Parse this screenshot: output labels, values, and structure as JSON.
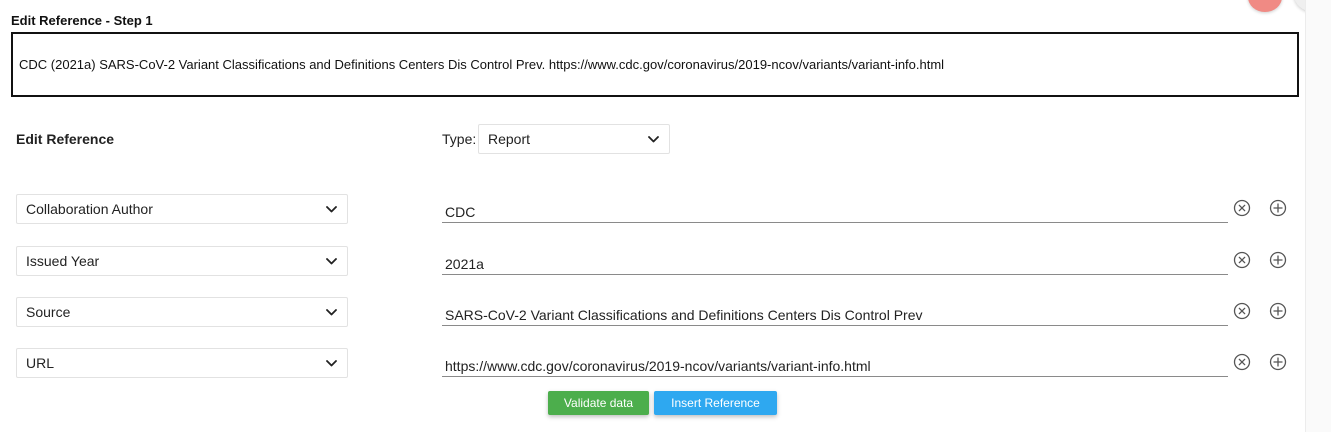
{
  "dialog": {
    "title": "Edit Reference - Step 1",
    "reference_text": "CDC (2021a) SARS-CoV-2 Variant Classifications and Definitions Centers Dis Control Prev. https://www.cdc.gov/coronavirus/2019-ncov/variants/variant-info.html"
  },
  "edit_section": {
    "title": "Edit Reference",
    "type_label": "Type:",
    "type_value": "Report"
  },
  "fields": [
    {
      "field_type": "Collaboration Author",
      "value": "CDC"
    },
    {
      "field_type": "Issued Year",
      "value": "2021a"
    },
    {
      "field_type": "Source",
      "value": "SARS-CoV-2 Variant Classifications and Definitions Centers Dis Control Prev"
    },
    {
      "field_type": "URL",
      "value": "https://www.cdc.gov/coronavirus/2019-ncov/variants/variant-info.html"
    }
  ],
  "actions": {
    "validate_label": "Validate data",
    "insert_label": "Insert Reference"
  },
  "colors": {
    "validate_button": "#4cae4c",
    "insert_button": "#2ea8f0",
    "corner_button": "#f08a84"
  },
  "icons": {
    "remove": "remove-circle-icon",
    "add": "add-circle-icon",
    "dropdown": "chevron-down-icon"
  }
}
